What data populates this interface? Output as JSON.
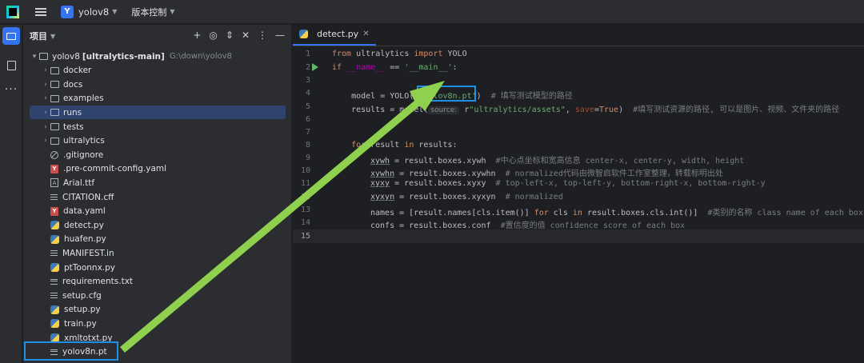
{
  "topbar": {
    "project_badge": "Y",
    "project_name": "yolov8",
    "vcs_label": "版本控制"
  },
  "project_panel": {
    "title": "项目",
    "root": {
      "name": "yolov8",
      "module": "[ultralytics-main]",
      "path": "G:\\down\\yolov8"
    },
    "items": [
      {
        "label": "docker",
        "icon": "folder"
      },
      {
        "label": "docs",
        "icon": "folder"
      },
      {
        "label": "examples",
        "icon": "folder"
      },
      {
        "label": "runs",
        "icon": "folder",
        "selected": true
      },
      {
        "label": "tests",
        "icon": "folder"
      },
      {
        "label": "ultralytics",
        "icon": "package-folder"
      },
      {
        "label": ".gitignore",
        "icon": "ignore"
      },
      {
        "label": ".pre-commit-config.yaml",
        "icon": "yaml"
      },
      {
        "label": "Arial.ttf",
        "icon": "font"
      },
      {
        "label": "CITATION.cff",
        "icon": "text"
      },
      {
        "label": "data.yaml",
        "icon": "yaml"
      },
      {
        "label": "detect.py",
        "icon": "python"
      },
      {
        "label": "huafen.py",
        "icon": "python"
      },
      {
        "label": "MANIFEST.in",
        "icon": "text"
      },
      {
        "label": "ptToonnx.py",
        "icon": "python"
      },
      {
        "label": "requirements.txt",
        "icon": "text"
      },
      {
        "label": "setup.cfg",
        "icon": "text"
      },
      {
        "label": "setup.py",
        "icon": "python"
      },
      {
        "label": "train.py",
        "icon": "python"
      },
      {
        "label": "xmltotxt.py",
        "icon": "python"
      },
      {
        "label": "yolov8n.pt",
        "icon": "text"
      }
    ]
  },
  "editor": {
    "tab": "detect.py",
    "line_numbers": [
      "1",
      "2",
      "3",
      "4",
      "5",
      "6",
      "7",
      "8",
      "9",
      "10",
      "11",
      "12",
      "13",
      "14",
      "15"
    ],
    "code": {
      "l1_from": "from",
      "l1_mod": " ultralytics ",
      "l1_import": "import",
      "l1_cls": " YOLO",
      "l2_if": "if",
      "l2_name": " __name__",
      "l2_eq": " == ",
      "l2_main": "'__main__'",
      "l2_colon": ":",
      "l4_a": "    model = YOLO(r",
      "l4_str": "'yolov8n.pt'",
      "l4_b": ")  ",
      "l4_cm": "# 填写测试模型的路径",
      "l5_a": "    results = model(",
      "l5_hint": "source:",
      "l5_b": " r",
      "l5_str": "\"ultralytics/assets\"",
      "l5_c": ", ",
      "l5_prm": "save",
      "l5_d": "=",
      "l5_true": "True",
      "l5_e": ")  ",
      "l5_cm": "#填写测试资源的路径, 可以是图片、视频、文件夹的路径",
      "l8_for": "    for",
      "l8_a": " result ",
      "l8_in": "in",
      "l8_b": " results:",
      "l9_v": "xywh",
      "l9_a": " = result.boxes.xywh  ",
      "l9_cm": "#中心点坐标和宽高信息 center-x, center-y, width, height",
      "l10_v": "xywhn",
      "l10_a": " = result.boxes.xywhn  ",
      "l10_cm": "# normalized代码由微智启软件工作室整理，转载标明出处",
      "l11_v": "xyxy",
      "l11_a": " = result.boxes.xyxy  ",
      "l11_cm": "# top-left-x, top-left-y, bottom-right-x, bottom-right-y",
      "l12_v": "xyxyn",
      "l12_a": " = result.boxes.xyxyn  ",
      "l12_cm": "# normalized",
      "l13_a": "names = [result.names[cls.item()] ",
      "l13_for": "for",
      "l13_b": " cls ",
      "l13_in": "in",
      "l13_c": " result.boxes.cls.int()]  ",
      "l13_cm": "#类别的名称 class name of each box",
      "l14_a": "confs = result.boxes.conf  ",
      "l14_cm": "#置信度的值 confidence score of each box"
    }
  },
  "colors": {
    "accent": "#3574f0",
    "annotation_box": "#1e8fe6",
    "annotation_arrow": "#8fd14f"
  }
}
